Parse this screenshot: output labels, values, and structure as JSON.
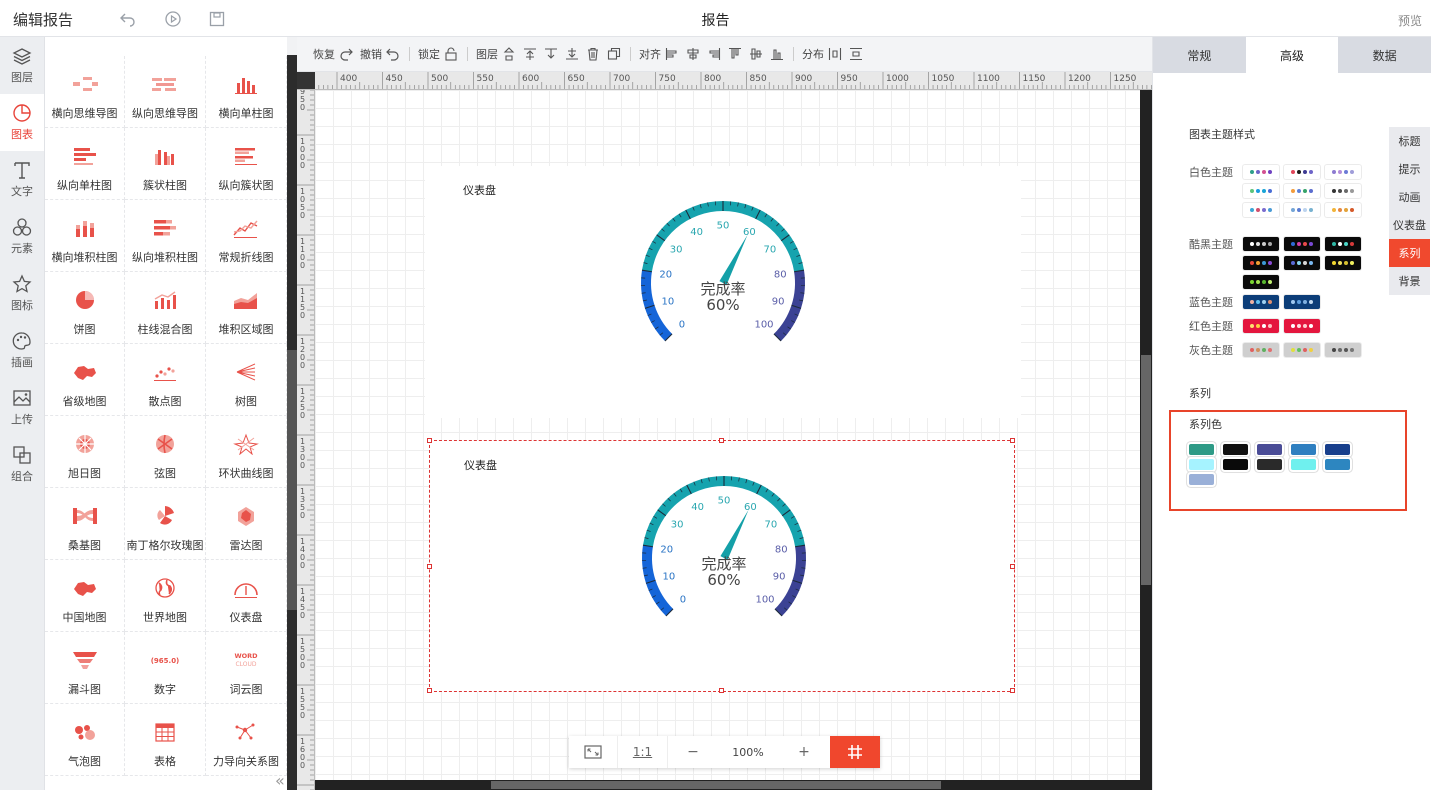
{
  "topbar": {
    "app_title": "编辑报告",
    "heading": "报告",
    "preview": "预览",
    "icons": [
      "undo-icon",
      "play-icon",
      "save-icon"
    ]
  },
  "leftnav": [
    {
      "id": "layers",
      "label": "图层",
      "icon": "layers-icon"
    },
    {
      "id": "charts",
      "label": "图表",
      "icon": "pie-icon",
      "active": true
    },
    {
      "id": "text",
      "label": "文字",
      "icon": "text-icon"
    },
    {
      "id": "elements",
      "label": "元素",
      "icon": "shapes-icon"
    },
    {
      "id": "marks",
      "label": "图标",
      "icon": "star-icon"
    },
    {
      "id": "illust",
      "label": "插画",
      "icon": "palette-icon"
    },
    {
      "id": "upload",
      "label": "上传",
      "icon": "image-icon"
    },
    {
      "id": "group",
      "label": "组合",
      "icon": "group-icon"
    }
  ],
  "palette": {
    "items": [
      {
        "label": "横向思维导图",
        "icon": "mindmap-h"
      },
      {
        "label": "纵向思维导图",
        "icon": "mindmap-v"
      },
      {
        "label": "横向单柱图",
        "icon": "bar-v"
      },
      {
        "label": "纵向单柱图",
        "icon": "bar-h"
      },
      {
        "label": "簇状柱图",
        "icon": "bar-group"
      },
      {
        "label": "纵向簇状图",
        "icon": "bar-h2"
      },
      {
        "label": "横向堆积柱图",
        "icon": "stack-v"
      },
      {
        "label": "纵向堆积柱图",
        "icon": "stack-h"
      },
      {
        "label": "常规折线图",
        "icon": "line"
      },
      {
        "label": "饼图",
        "icon": "pie"
      },
      {
        "label": "柱线混合图",
        "icon": "mix"
      },
      {
        "label": "堆积区域图",
        "icon": "area"
      },
      {
        "label": "省级地图",
        "icon": "map"
      },
      {
        "label": "散点图",
        "icon": "scatter"
      },
      {
        "label": "树图",
        "icon": "tree"
      },
      {
        "label": "旭日图",
        "icon": "sunburst"
      },
      {
        "label": "弦图",
        "icon": "chord"
      },
      {
        "label": "环状曲线图",
        "icon": "ring"
      },
      {
        "label": "桑基图",
        "icon": "sankey"
      },
      {
        "label": "南丁格尔玫瑰图",
        "icon": "rose"
      },
      {
        "label": "雷达图",
        "icon": "radar"
      },
      {
        "label": "中国地图",
        "icon": "map"
      },
      {
        "label": "世界地图",
        "icon": "globe"
      },
      {
        "label": "仪表盘",
        "icon": "gauge"
      },
      {
        "label": "漏斗图",
        "icon": "funnel"
      },
      {
        "label": "数字",
        "icon": "number"
      },
      {
        "label": "词云图",
        "icon": "wordcloud"
      },
      {
        "label": "气泡图",
        "icon": "bubble"
      },
      {
        "label": "表格",
        "icon": "table"
      },
      {
        "label": "力导向关系图",
        "icon": "force"
      }
    ],
    "number_icon_text": "965.0",
    "wordcloud_text": [
      "WORD",
      "CLOUD"
    ],
    "collapse": "«"
  },
  "toolbar": [
    {
      "label": "恢复",
      "icon": "redo-icon"
    },
    {
      "label": "撤销",
      "icon": "undo-icon"
    },
    "sep",
    {
      "label": "锁定",
      "icon": "lock-icon"
    },
    "sep",
    {
      "label": "图层",
      "icon": "layer-up-icon"
    },
    {
      "icon": "layer-top-icon"
    },
    {
      "icon": "layer-down-icon"
    },
    {
      "icon": "layer-bottom-icon"
    },
    {
      "icon": "delete-icon"
    },
    {
      "icon": "copy-icon"
    },
    "sep",
    {
      "label": "对齐",
      "icon": "align-left-icon"
    },
    {
      "icon": "align-center-icon"
    },
    {
      "icon": "align-right-icon"
    },
    {
      "icon": "align-top-icon"
    },
    {
      "icon": "align-middle-icon"
    },
    {
      "icon": "align-bottom-icon"
    },
    "sep",
    {
      "label": "分布",
      "icon": "dist-h-icon"
    },
    {
      "icon": "dist-v-icon"
    }
  ],
  "rulers": {
    "top": [
      "400",
      "450",
      "500",
      "550",
      "600",
      "650",
      "700",
      "750",
      "800",
      "850",
      "900",
      "950",
      "1000",
      "1050",
      "1100",
      "1150",
      "1200",
      "1250"
    ],
    "left": [
      "950",
      "1000",
      "1050",
      "1100",
      "1150",
      "1200",
      "1250",
      "1300",
      "1350",
      "1400",
      "1450",
      "1500",
      "1550",
      "1600"
    ]
  },
  "widgets": [
    {
      "title": "仪表盘",
      "gauge": {
        "value": 60,
        "label": "完成率",
        "value_text": "60%",
        "min": 0,
        "max": 100,
        "ticks": [
          "0",
          "10",
          "20",
          "30",
          "40",
          "50",
          "60",
          "70",
          "80",
          "90",
          "100"
        ]
      }
    },
    {
      "title": "仪表盘",
      "selected": true,
      "gauge": {
        "value": 60,
        "label": "完成率",
        "value_text": "60%",
        "min": 0,
        "max": 100,
        "ticks": [
          "0",
          "10",
          "20",
          "30",
          "40",
          "50",
          "60",
          "70",
          "80",
          "90",
          "100"
        ]
      }
    }
  ],
  "gauge_colors": {
    "band1": "#1565d8",
    "band2": "#16a3ae",
    "band3": "#3b4294",
    "pointer": "#14a0a8",
    "label_low": "#2a74c5",
    "label_mid": "#2aa7b0",
    "label_high": "#5a5ea8"
  },
  "zoom": {
    "fit": "fit-icon",
    "ratio": "1:1",
    "minus": "−",
    "value": "100%",
    "plus": "+",
    "grid": "grid-icon"
  },
  "right": {
    "tabs": [
      "常规",
      "高级",
      "数据"
    ],
    "active_tab": 1,
    "theme_title": "图表主题样式",
    "themes": [
      {
        "name": "白色主题",
        "swatches": [
          {
            "bg": "#ffffff",
            "dots": [
              "#2e9f8a",
              "#6d64c8",
              "#d35191",
              "#6f42c1"
            ]
          },
          {
            "bg": "#ffffff",
            "dots": [
              "#e2465a",
              "#1a1a1a",
              "#3e3b92",
              "#6d64c8"
            ]
          },
          {
            "bg": "#ffffff",
            "dots": [
              "#8d7bd1",
              "#b48ed9",
              "#6c7bd6",
              "#a09dd9"
            ]
          },
          {
            "bg": "#ffffff",
            "dots": [
              "#5cc47a",
              "#1a9be0",
              "#19a4d6",
              "#4a6ed6"
            ]
          },
          {
            "bg": "#ffffff",
            "dots": [
              "#f39c3c",
              "#5b80d8",
              "#36a36a",
              "#5b6dcf"
            ]
          },
          {
            "bg": "#ffffff",
            "dots": [
              "#333333",
              "#4a4a4a",
              "#6a6a6a",
              "#999999"
            ]
          },
          {
            "bg": "#ffffff",
            "dots": [
              "#3aa6d6",
              "#d14f6d",
              "#7a6ccf",
              "#4a9bd6"
            ]
          },
          {
            "bg": "#ffffff",
            "dots": [
              "#74a5d6",
              "#5b7ed3",
              "#bcd3ee",
              "#78b2d0"
            ]
          },
          {
            "bg": "#ffffff",
            "dots": [
              "#f1b43a",
              "#e68840",
              "#e3a33a",
              "#d55a2a"
            ]
          }
        ]
      },
      {
        "name": "酷黑主题",
        "swatches": [
          {
            "bg": "#0a0a0a",
            "dots": [
              "#ffffff",
              "#e0e0e0",
              "#cccccc",
              "#aaaaaa"
            ]
          },
          {
            "bg": "#0a0a0a",
            "dots": [
              "#2e6bd6",
              "#d13fa5",
              "#e84a4a",
              "#7a4ad6"
            ]
          },
          {
            "bg": "#0a0a0a",
            "dots": [
              "#2fb8a6",
              "#ffffff",
              "#4bd6c8",
              "#d63a3a"
            ]
          },
          {
            "bg": "#0a0a0a",
            "dots": [
              "#e84a3a",
              "#f0a030",
              "#3c9ad6",
              "#8a4ad6"
            ]
          },
          {
            "bg": "#0a0a0a",
            "dots": [
              "#5a6ad6",
              "#8ad6f0",
              "#d6d6d6",
              "#7ab8f0"
            ]
          },
          {
            "bg": "#0a0a0a",
            "dots": [
              "#f0d630",
              "#f0e060",
              "#d6c030",
              "#f0f060"
            ]
          },
          {
            "bg": "#0a0a0a",
            "dots": [
              "#7ad630",
              "#a0e050",
              "#5ab830",
              "#c0f070"
            ]
          }
        ]
      },
      {
        "name": "蓝色主题",
        "swatches": [
          {
            "bg": "#0c3d78",
            "dots": [
              "#f0b0a0",
              "#60c0f0",
              "#a0d0f0",
              "#e09070"
            ]
          },
          {
            "bg": "#0c3d78",
            "dots": [
              "#a0c8f0",
              "#60a0e0",
              "#80b0e0",
              "#c0d8f0"
            ]
          }
        ]
      },
      {
        "name": "红色主题",
        "swatches": [
          {
            "bg": "#e4163e",
            "dots": [
              "#ffe070",
              "#ffd040",
              "#ffffff",
              "#ffc0c0"
            ]
          },
          {
            "bg": "#e4163e",
            "dots": [
              "#ffffff",
              "#ffe0e0",
              "#ffd0d0",
              "#ffffff"
            ]
          }
        ]
      },
      {
        "name": "灰色主题",
        "swatches": [
          {
            "bg": "#cfcfcf",
            "dots": [
              "#e06060",
              "#d09060",
              "#60b060",
              "#e07070"
            ]
          },
          {
            "bg": "#cfcfcf",
            "dots": [
              "#e0e040",
              "#60c060",
              "#e06060",
              "#f0d040"
            ]
          },
          {
            "bg": "#cfcfcf",
            "dots": [
              "#444444",
              "#666666",
              "#555555",
              "#777777"
            ]
          }
        ]
      }
    ],
    "vtabs": [
      "标题",
      "提示",
      "动画",
      "仪表盘",
      "系列",
      "背景"
    ],
    "active_vtab": 4,
    "series_heading": "系列",
    "series_color_label": "系列色",
    "series_colors": [
      "#2e9a86",
      "#111111",
      "#4a4c96",
      "#2f7fc0",
      "#183f8c",
      "#a6f3ff",
      "#0a0a0a",
      "#2a2a2a",
      "#6ff0ee",
      "#2d86c0",
      "#9ab0d8"
    ]
  }
}
